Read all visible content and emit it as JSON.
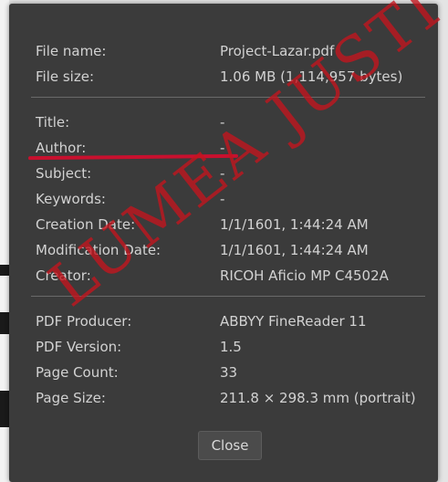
{
  "dialog": {
    "rows": [
      {
        "label": "File name:",
        "value": "Project-Lazar.pdf"
      },
      {
        "label": "File size:",
        "value": "1.06 MB (1,114,957 bytes)"
      },
      {
        "label": "Title:",
        "value": "-"
      },
      {
        "label": "Author:",
        "value": "-"
      },
      {
        "label": "Subject:",
        "value": "-"
      },
      {
        "label": "Keywords:",
        "value": "-"
      },
      {
        "label": "Creation Date:",
        "value": "1/1/1601, 1:44:24 AM"
      },
      {
        "label": "Modification Date:",
        "value": "1/1/1601, 1:44:24 AM"
      },
      {
        "label": "Creator:",
        "value": "RICOH Aficio MP C4502A"
      },
      {
        "label": "PDF Producer:",
        "value": "ABBYY FineReader 11"
      },
      {
        "label": "PDF Version:",
        "value": "1.5"
      },
      {
        "label": "Page Count:",
        "value": "33"
      },
      {
        "label": "Page Size:",
        "value": "211.8 × 298.3 mm (portrait)"
      }
    ],
    "close_label": "Close"
  },
  "annotation": {
    "underline_color": "#c8102e",
    "watermark_text": "LUMEA JUSTITIEI",
    "watermark_color": "#c4141e"
  }
}
